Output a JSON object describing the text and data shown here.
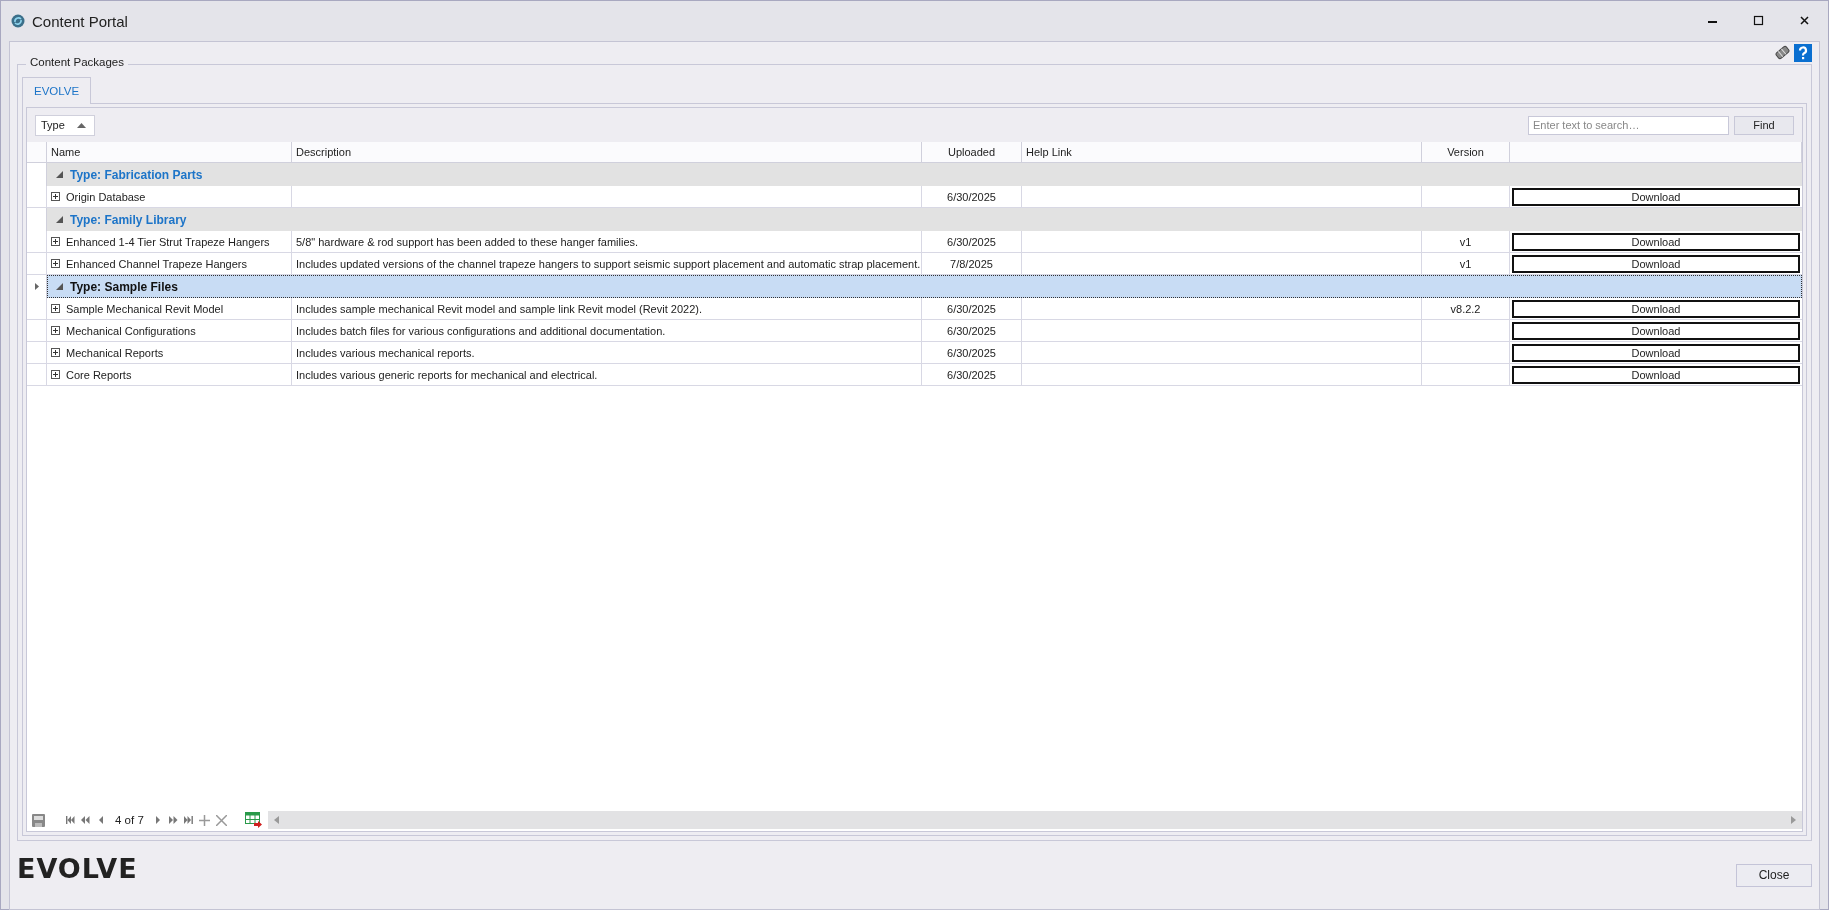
{
  "window": {
    "title": "Content Portal"
  },
  "group_box": {
    "title": "Content Packages"
  },
  "tabs": [
    {
      "label": "EVOLVE",
      "selected": true
    }
  ],
  "toolbar": {
    "group_by": "Type",
    "search": {
      "placeholder": "Enter text to search…"
    },
    "find_button": "Find"
  },
  "table": {
    "columns": [
      "Name",
      "Description",
      "Uploaded",
      "Help Link",
      "Version"
    ],
    "groups": [
      {
        "title": "Type: Fabrication Parts",
        "expanded": true,
        "selected": false,
        "rows": [
          {
            "name": "Origin Database",
            "description": "",
            "uploaded": "6/30/2025",
            "version": "",
            "action": "Download"
          }
        ]
      },
      {
        "title": "Type: Family Library",
        "expanded": true,
        "selected": false,
        "rows": [
          {
            "name": "Enhanced 1-4 Tier Strut Trapeze Hangers",
            "description": "5/8\" hardware & rod support has been added to these hanger families.",
            "uploaded": "6/30/2025",
            "version": "v1",
            "action": "Download"
          },
          {
            "name": "Enhanced Channel Trapeze Hangers",
            "description": "Includes updated versions of the channel trapeze hangers to support seismic support placement and automatic strap placement.",
            "uploaded": "7/8/2025",
            "version": "v1",
            "action": "Download"
          }
        ]
      },
      {
        "title": "Type: Sample Files",
        "expanded": true,
        "selected": true,
        "rows": [
          {
            "name": "Sample Mechanical Revit Model",
            "description": "Includes sample mechanical Revit model and sample link Revit model (Revit 2022).",
            "uploaded": "6/30/2025",
            "version": "v8.2.2",
            "action": "Download"
          },
          {
            "name": "Mechanical Configurations",
            "description": "Includes batch files for various configurations and additional documentation.",
            "uploaded": "6/30/2025",
            "version": "",
            "action": "Download"
          },
          {
            "name": "Mechanical Reports",
            "description": "Includes various mechanical reports.",
            "uploaded": "6/30/2025",
            "version": "",
            "action": "Download"
          },
          {
            "name": "Core Reports",
            "description": "Includes various generic reports for mechanical and electrical.",
            "uploaded": "6/30/2025",
            "version": "",
            "action": "Download"
          }
        ]
      }
    ]
  },
  "navigator": {
    "position": "4 of 7"
  },
  "logo": "EVOLVE",
  "close_button": "Close"
}
